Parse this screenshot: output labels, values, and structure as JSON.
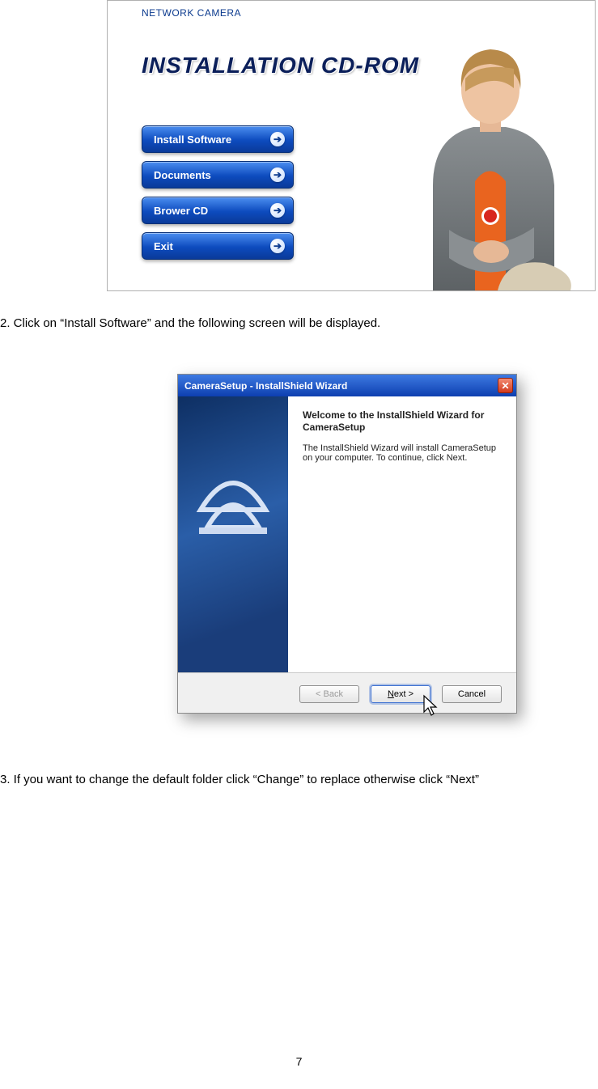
{
  "cdrom_panel": {
    "small_title": "NETWORK CAMERA",
    "big_title": "INSTALLATION CD-ROM",
    "menu": [
      "Install Software",
      "Documents",
      "Brower CD",
      "Exit"
    ]
  },
  "step2_text": "2. Click on “Install Software” and the following screen will be displayed.",
  "step3_text": "3. If you want to change the default folder click “Change” to replace otherwise click “Next”",
  "installer": {
    "title": "CameraSetup - InstallShield Wizard",
    "welcome_heading": "Welcome to the InstallShield Wizard for CameraSetup",
    "welcome_body": "The InstallShield Wizard will install CameraSetup on your computer.  To continue, click Next.",
    "buttons": {
      "back": "< Back",
      "next_prefix": "N",
      "next_rest": "ext >",
      "cancel": "Cancel"
    }
  },
  "page_number": "7"
}
